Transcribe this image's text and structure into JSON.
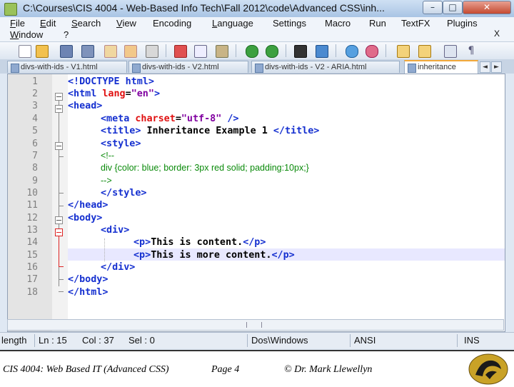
{
  "window": {
    "title": "C:\\Courses\\CIS 4004 - Web-Based Info Tech\\Fall 2012\\code\\Advanced CSS\\inh...",
    "buttons": [
      "–",
      "□",
      "✕"
    ]
  },
  "menu": {
    "items": [
      {
        "u": "F",
        "rest": "ile"
      },
      {
        "u": "E",
        "rest": "dit"
      },
      {
        "u": "S",
        "rest": "earch"
      },
      {
        "u": "V",
        "rest": "iew"
      },
      {
        "u": "",
        "rest": "Encoding"
      },
      {
        "u": "L",
        "rest": "anguage"
      },
      {
        "u": "",
        "rest": "Settings"
      },
      {
        "u": "",
        "rest": "Macro"
      },
      {
        "u": "",
        "rest": "Run"
      },
      {
        "u": "",
        "rest": "TextFX"
      },
      {
        "u": "",
        "rest": "Plugins"
      },
      {
        "u": "W",
        "rest": "indow"
      },
      {
        "u": "",
        "rest": "?"
      }
    ],
    "close_x": "X"
  },
  "tabs": [
    {
      "label": "divs-with-ids - V1.html"
    },
    {
      "label": "divs-with-ids - V2.html"
    },
    {
      "label": "divs-with-ids - V2 - ARIA.html"
    },
    {
      "label": "inheritance"
    }
  ],
  "tab_arrows": [
    "◄",
    "►"
  ],
  "code_lines": [
    {
      "n": "1"
    },
    {
      "n": "2"
    },
    {
      "n": "3"
    },
    {
      "n": "4"
    },
    {
      "n": "5"
    },
    {
      "n": "6"
    },
    {
      "n": "7"
    },
    {
      "n": "8"
    },
    {
      "n": "9"
    },
    {
      "n": "10"
    },
    {
      "n": "11"
    },
    {
      "n": "12"
    },
    {
      "n": "13"
    },
    {
      "n": "14"
    },
    {
      "n": "15"
    },
    {
      "n": "16"
    },
    {
      "n": "17"
    },
    {
      "n": "18"
    }
  ],
  "code": {
    "l1": "<!DOCTYPE html>",
    "l2a": "<html ",
    "l2b": "lang",
    "l2c": "=",
    "l2d": "\"en\"",
    "l2e": ">",
    "l3": "<head>",
    "l4a": "<meta ",
    "l4b": "charset",
    "l4c": "=",
    "l4d": "\"utf-8\"",
    "l4e": " />",
    "l5a": "<title>",
    "l5b": " Inheritance Example 1 ",
    "l5c": "</title>",
    "l6": "<style>",
    "l7": "<!--",
    "l8": "div {color: blue; border: 3px red solid; padding:10px;}",
    "l9": "-->",
    "l10": "</style>",
    "l11": "</head>",
    "l12": "<body>",
    "l13": "<div>",
    "l14a": "<p>",
    "l14b": "This is content.",
    "l14c": "</p>",
    "l15a": "<p>",
    "l15b": "This is more content.",
    "l15c": "</p>",
    "l16": "</div>",
    "l17": "</body>",
    "l18": "</html>"
  },
  "status": {
    "length": "length",
    "ln": "Ln : 15",
    "col": "Col : 37",
    "sel": "Sel : 0",
    "eol": "Dos\\Windows",
    "enc": "ANSI",
    "mode": "INS"
  },
  "footer": {
    "course": "CIS 4004: Web Based IT (Advanced CSS)",
    "page": "Page 4",
    "author": "© Dr. Mark Llewellyn"
  },
  "colors": {
    "tag": "#1530d0",
    "attr": "#e01010",
    "value": "#8000a0",
    "comment": "#0a8a0a",
    "tab_accent": "#f3a93a"
  }
}
